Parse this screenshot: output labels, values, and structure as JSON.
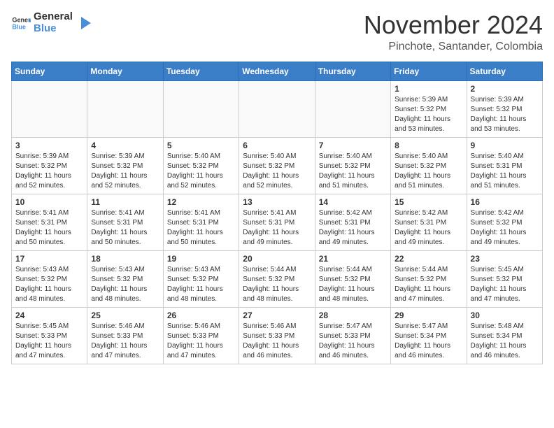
{
  "header": {
    "logo_general": "General",
    "logo_blue": "Blue",
    "month_title": "November 2024",
    "location": "Pinchote, Santander, Colombia"
  },
  "weekdays": [
    "Sunday",
    "Monday",
    "Tuesday",
    "Wednesday",
    "Thursday",
    "Friday",
    "Saturday"
  ],
  "weeks": [
    [
      {
        "day": "",
        "sunrise": "",
        "sunset": "",
        "daylight": "",
        "empty": true
      },
      {
        "day": "",
        "sunrise": "",
        "sunset": "",
        "daylight": "",
        "empty": true
      },
      {
        "day": "",
        "sunrise": "",
        "sunset": "",
        "daylight": "",
        "empty": true
      },
      {
        "day": "",
        "sunrise": "",
        "sunset": "",
        "daylight": "",
        "empty": true
      },
      {
        "day": "",
        "sunrise": "",
        "sunset": "",
        "daylight": "",
        "empty": true
      },
      {
        "day": "1",
        "sunrise": "Sunrise: 5:39 AM",
        "sunset": "Sunset: 5:32 PM",
        "daylight": "Daylight: 11 hours and 53 minutes.",
        "empty": false
      },
      {
        "day": "2",
        "sunrise": "Sunrise: 5:39 AM",
        "sunset": "Sunset: 5:32 PM",
        "daylight": "Daylight: 11 hours and 53 minutes.",
        "empty": false
      }
    ],
    [
      {
        "day": "3",
        "sunrise": "Sunrise: 5:39 AM",
        "sunset": "Sunset: 5:32 PM",
        "daylight": "Daylight: 11 hours and 52 minutes.",
        "empty": false
      },
      {
        "day": "4",
        "sunrise": "Sunrise: 5:39 AM",
        "sunset": "Sunset: 5:32 PM",
        "daylight": "Daylight: 11 hours and 52 minutes.",
        "empty": false
      },
      {
        "day": "5",
        "sunrise": "Sunrise: 5:40 AM",
        "sunset": "Sunset: 5:32 PM",
        "daylight": "Daylight: 11 hours and 52 minutes.",
        "empty": false
      },
      {
        "day": "6",
        "sunrise": "Sunrise: 5:40 AM",
        "sunset": "Sunset: 5:32 PM",
        "daylight": "Daylight: 11 hours and 52 minutes.",
        "empty": false
      },
      {
        "day": "7",
        "sunrise": "Sunrise: 5:40 AM",
        "sunset": "Sunset: 5:32 PM",
        "daylight": "Daylight: 11 hours and 51 minutes.",
        "empty": false
      },
      {
        "day": "8",
        "sunrise": "Sunrise: 5:40 AM",
        "sunset": "Sunset: 5:32 PM",
        "daylight": "Daylight: 11 hours and 51 minutes.",
        "empty": false
      },
      {
        "day": "9",
        "sunrise": "Sunrise: 5:40 AM",
        "sunset": "Sunset: 5:31 PM",
        "daylight": "Daylight: 11 hours and 51 minutes.",
        "empty": false
      }
    ],
    [
      {
        "day": "10",
        "sunrise": "Sunrise: 5:41 AM",
        "sunset": "Sunset: 5:31 PM",
        "daylight": "Daylight: 11 hours and 50 minutes.",
        "empty": false
      },
      {
        "day": "11",
        "sunrise": "Sunrise: 5:41 AM",
        "sunset": "Sunset: 5:31 PM",
        "daylight": "Daylight: 11 hours and 50 minutes.",
        "empty": false
      },
      {
        "day": "12",
        "sunrise": "Sunrise: 5:41 AM",
        "sunset": "Sunset: 5:31 PM",
        "daylight": "Daylight: 11 hours and 50 minutes.",
        "empty": false
      },
      {
        "day": "13",
        "sunrise": "Sunrise: 5:41 AM",
        "sunset": "Sunset: 5:31 PM",
        "daylight": "Daylight: 11 hours and 49 minutes.",
        "empty": false
      },
      {
        "day": "14",
        "sunrise": "Sunrise: 5:42 AM",
        "sunset": "Sunset: 5:31 PM",
        "daylight": "Daylight: 11 hours and 49 minutes.",
        "empty": false
      },
      {
        "day": "15",
        "sunrise": "Sunrise: 5:42 AM",
        "sunset": "Sunset: 5:31 PM",
        "daylight": "Daylight: 11 hours and 49 minutes.",
        "empty": false
      },
      {
        "day": "16",
        "sunrise": "Sunrise: 5:42 AM",
        "sunset": "Sunset: 5:32 PM",
        "daylight": "Daylight: 11 hours and 49 minutes.",
        "empty": false
      }
    ],
    [
      {
        "day": "17",
        "sunrise": "Sunrise: 5:43 AM",
        "sunset": "Sunset: 5:32 PM",
        "daylight": "Daylight: 11 hours and 48 minutes.",
        "empty": false
      },
      {
        "day": "18",
        "sunrise": "Sunrise: 5:43 AM",
        "sunset": "Sunset: 5:32 PM",
        "daylight": "Daylight: 11 hours and 48 minutes.",
        "empty": false
      },
      {
        "day": "19",
        "sunrise": "Sunrise: 5:43 AM",
        "sunset": "Sunset: 5:32 PM",
        "daylight": "Daylight: 11 hours and 48 minutes.",
        "empty": false
      },
      {
        "day": "20",
        "sunrise": "Sunrise: 5:44 AM",
        "sunset": "Sunset: 5:32 PM",
        "daylight": "Daylight: 11 hours and 48 minutes.",
        "empty": false
      },
      {
        "day": "21",
        "sunrise": "Sunrise: 5:44 AM",
        "sunset": "Sunset: 5:32 PM",
        "daylight": "Daylight: 11 hours and 48 minutes.",
        "empty": false
      },
      {
        "day": "22",
        "sunrise": "Sunrise: 5:44 AM",
        "sunset": "Sunset: 5:32 PM",
        "daylight": "Daylight: 11 hours and 47 minutes.",
        "empty": false
      },
      {
        "day": "23",
        "sunrise": "Sunrise: 5:45 AM",
        "sunset": "Sunset: 5:32 PM",
        "daylight": "Daylight: 11 hours and 47 minutes.",
        "empty": false
      }
    ],
    [
      {
        "day": "24",
        "sunrise": "Sunrise: 5:45 AM",
        "sunset": "Sunset: 5:33 PM",
        "daylight": "Daylight: 11 hours and 47 minutes.",
        "empty": false
      },
      {
        "day": "25",
        "sunrise": "Sunrise: 5:46 AM",
        "sunset": "Sunset: 5:33 PM",
        "daylight": "Daylight: 11 hours and 47 minutes.",
        "empty": false
      },
      {
        "day": "26",
        "sunrise": "Sunrise: 5:46 AM",
        "sunset": "Sunset: 5:33 PM",
        "daylight": "Daylight: 11 hours and 47 minutes.",
        "empty": false
      },
      {
        "day": "27",
        "sunrise": "Sunrise: 5:46 AM",
        "sunset": "Sunset: 5:33 PM",
        "daylight": "Daylight: 11 hours and 46 minutes.",
        "empty": false
      },
      {
        "day": "28",
        "sunrise": "Sunrise: 5:47 AM",
        "sunset": "Sunset: 5:33 PM",
        "daylight": "Daylight: 11 hours and 46 minutes.",
        "empty": false
      },
      {
        "day": "29",
        "sunrise": "Sunrise: 5:47 AM",
        "sunset": "Sunset: 5:34 PM",
        "daylight": "Daylight: 11 hours and 46 minutes.",
        "empty": false
      },
      {
        "day": "30",
        "sunrise": "Sunrise: 5:48 AM",
        "sunset": "Sunset: 5:34 PM",
        "daylight": "Daylight: 11 hours and 46 minutes.",
        "empty": false
      }
    ]
  ]
}
